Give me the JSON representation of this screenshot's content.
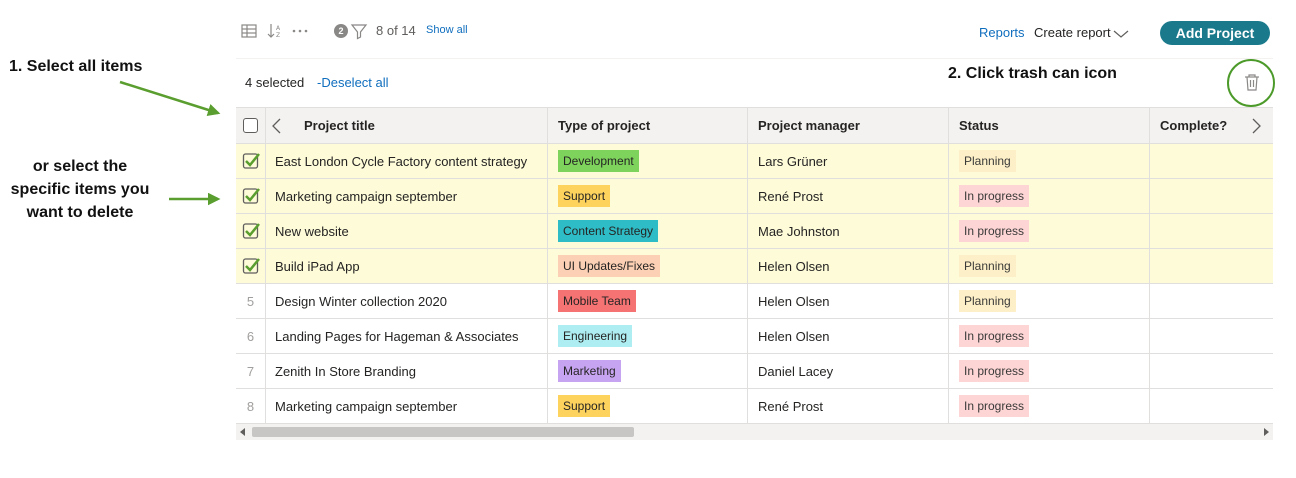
{
  "toolbar": {
    "grid_icon": "table-grid-icon",
    "sort_icon": "sort-az-icon",
    "more_icon": "more-horizontal-icon",
    "filter_active_count": "2",
    "filter_icon": "filter-icon",
    "count_text": "8 of 14",
    "show_all": "Show all",
    "reports": "Reports",
    "create_report": "Create report",
    "add_project": "Add Project"
  },
  "selection": {
    "count_text": "4 selected",
    "deselect": "-Deselect all",
    "trash_icon": "trash-can-icon"
  },
  "annotations": {
    "step1": "1. Select all items",
    "or_select": "or select the specific items you want to delete",
    "step2": "2. Click trash can icon",
    "accent_color": "#5a9e2f"
  },
  "table": {
    "columns": [
      "Project title",
      "Type of project",
      "Project manager",
      "Status",
      "Complete?"
    ],
    "rows": [
      {
        "num": "",
        "selected": true,
        "title": "East London Cycle Factory content strategy",
        "type": "Development",
        "type_color": "#7ed35c",
        "manager": "Lars Grüner",
        "status": "Planning",
        "status_kind": "planning"
      },
      {
        "num": "",
        "selected": true,
        "title": "Marketing campaign september",
        "type": "Support",
        "type_color": "#fdd25d",
        "manager": "René Prost",
        "status": "In progress",
        "status_kind": "progress"
      },
      {
        "num": "",
        "selected": true,
        "title": "New website",
        "type": "Content Strategy",
        "type_color": "#2ebdc6",
        "manager": "Mae Johnston",
        "status": "In progress",
        "status_kind": "progress"
      },
      {
        "num": "",
        "selected": true,
        "title": "Build iPad App",
        "type": "UI Updates/Fixes",
        "type_color": "#fcd0b4",
        "manager": "Helen Olsen",
        "status": "Planning",
        "status_kind": "planning"
      },
      {
        "num": "5",
        "selected": false,
        "title": "Design Winter collection 2020",
        "type": "Mobile Team",
        "type_color": "#f57373",
        "manager": "Helen Olsen",
        "status": "Planning",
        "status_kind": "planning"
      },
      {
        "num": "6",
        "selected": false,
        "title": "Landing Pages for Hageman & Associates",
        "type": "Engineering",
        "type_color": "#aeeef2",
        "manager": "Helen Olsen",
        "status": "In progress",
        "status_kind": "progress"
      },
      {
        "num": "7",
        "selected": false,
        "title": "Zenith In Store Branding",
        "type": "Marketing",
        "type_color": "#c7a4f2",
        "manager": "Daniel Lacey",
        "status": "In progress",
        "status_kind": "progress"
      },
      {
        "num": "8",
        "selected": false,
        "title": "Marketing campaign september",
        "type": "Support",
        "type_color": "#fdd25d",
        "manager": "René Prost",
        "status": "In progress",
        "status_kind": "progress"
      }
    ]
  }
}
